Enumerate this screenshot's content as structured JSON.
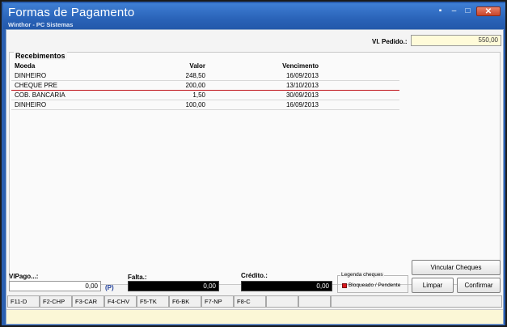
{
  "window": {
    "title": "Formas de Pagamento",
    "subtitle": "Winthor - PC Sistemas",
    "controls": {
      "restore": "▪",
      "minimize": "–",
      "maximize": "□",
      "close": "✕"
    }
  },
  "vl_pedido": {
    "label": "Vl. Pedido.:",
    "value": "550,00"
  },
  "recebimentos": {
    "title": "Recebimentos",
    "columns": {
      "moeda": "Moeda",
      "valor": "Valor",
      "vencimento": "Vencimento"
    },
    "rows": [
      {
        "moeda": "DINHEIRO",
        "valor": "248,50",
        "vencimento": "16/09/2013"
      },
      {
        "moeda": "CHEQUE PRE",
        "valor": "200,00",
        "vencimento": "13/10/2013"
      },
      {
        "moeda": "COB. BANCARIA",
        "valor": "1,50",
        "vencimento": "30/09/2013"
      },
      {
        "moeda": "DINHEIRO",
        "valor": "100,00",
        "vencimento": "16/09/2013"
      }
    ]
  },
  "footer": {
    "vlpago": {
      "label": "VlPago...:",
      "value": "0,00",
      "flag": "(P)"
    },
    "falta": {
      "label": "Falta.:",
      "value": "0,00"
    },
    "credito": {
      "label": "Crédito.:",
      "value": "0,00"
    },
    "legenda": {
      "title": "Legenda cheques",
      "item": "Bloqueado / Pendente",
      "color": "#d8161d"
    },
    "buttons": {
      "vincular": "Vincular Cheques",
      "limpar": "Limpar",
      "confirmar": "Confirmar"
    }
  },
  "function_keys": [
    "F11-D",
    "F2-CHP",
    "F3-CAR",
    "F4-CHV",
    "F5-TK",
    "F6-BK",
    "F7-NP",
    "F8-C"
  ],
  "colors": {
    "title_bar": "#2a63b8",
    "status_bar": "#fbf7d6",
    "selected_row_line": "#c0141a"
  }
}
